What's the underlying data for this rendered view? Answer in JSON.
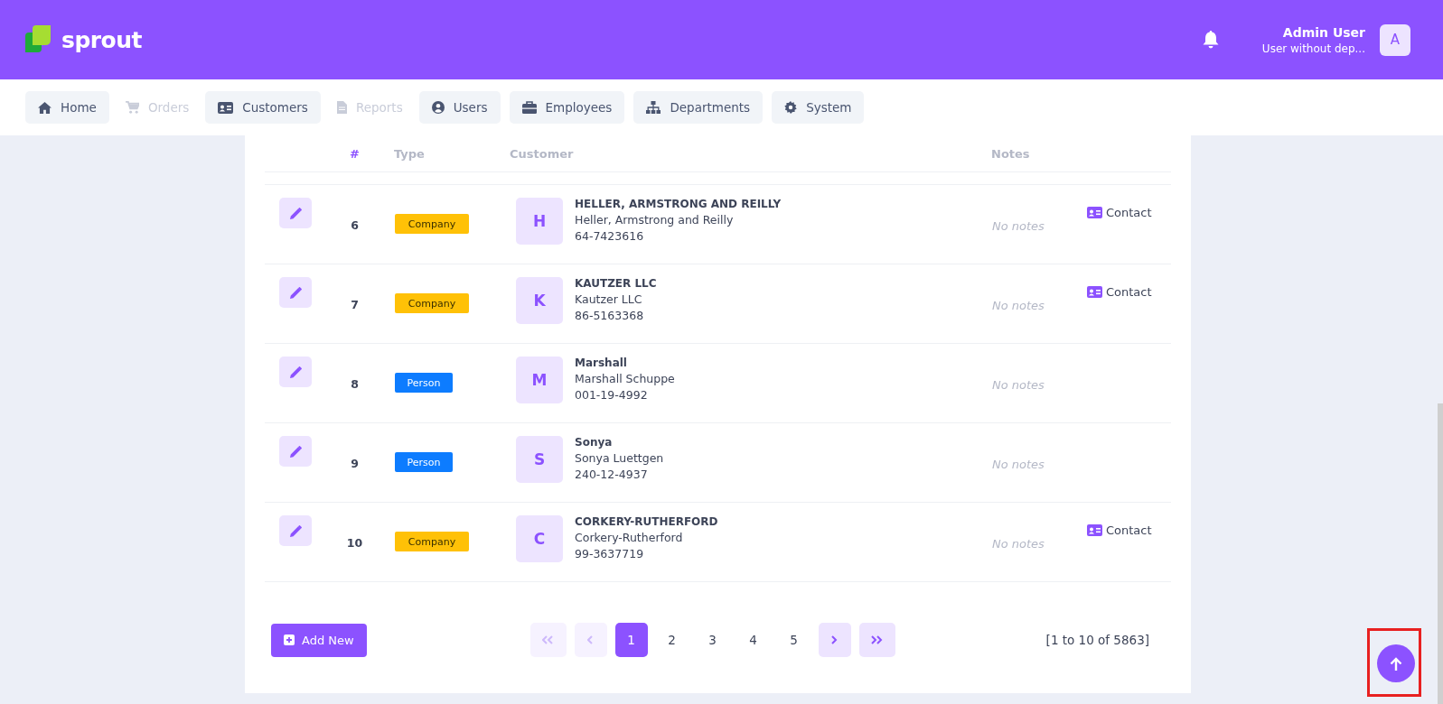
{
  "header": {
    "logo": "sprout",
    "user_name": "Admin User",
    "user_role": "User without dep...",
    "avatar": "A"
  },
  "nav": [
    {
      "label": "Home",
      "disabled": false
    },
    {
      "label": "Orders",
      "disabled": true
    },
    {
      "label": "Customers",
      "disabled": false
    },
    {
      "label": "Reports",
      "disabled": true
    },
    {
      "label": "Users",
      "disabled": false
    },
    {
      "label": "Employees",
      "disabled": false
    },
    {
      "label": "Departments",
      "disabled": false
    },
    {
      "label": "System",
      "disabled": false
    }
  ],
  "table": {
    "columns": [
      "#",
      "Type",
      "Customer",
      "Notes"
    ],
    "rows": [
      {
        "number": "6",
        "type": "Company",
        "kind": "company",
        "initial": "H",
        "title": "HELLER, ARMSTRONG AND REILLY",
        "name": "Heller, Armstrong and Reilly",
        "phone": "64-7423616",
        "notes": "No notes",
        "contact": "Contact"
      },
      {
        "number": "7",
        "type": "Company",
        "kind": "company",
        "initial": "K",
        "title": "KAUTZER LLC",
        "name": "Kautzer LLC",
        "phone": "86-5163368",
        "notes": "No notes",
        "contact": "Contact"
      },
      {
        "number": "8",
        "type": "Person",
        "kind": "person",
        "initial": "M",
        "title": "Marshall",
        "name": "Marshall Schuppe",
        "phone": "001-19-4992",
        "notes": "No notes"
      },
      {
        "number": "9",
        "type": "Person",
        "kind": "person",
        "initial": "S",
        "title": "Sonya",
        "name": "Sonya Luettgen",
        "phone": "240-12-4937",
        "notes": "No notes"
      },
      {
        "number": "10",
        "type": "Company",
        "kind": "company",
        "initial": "C",
        "title": "CORKERY-RUTHERFORD",
        "name": "Corkery-Rutherford",
        "phone": "99-3637719",
        "notes": "No notes",
        "contact": "Contact"
      }
    ]
  },
  "footer": {
    "add_button": "Add New",
    "first": {
      "disabled": true
    },
    "previous": {
      "disabled": true
    },
    "pages": [
      {
        "label": "1",
        "selected": true
      },
      {
        "label": "2",
        "selected": false
      },
      {
        "label": "3",
        "selected": false
      },
      {
        "label": "4",
        "selected": false
      },
      {
        "label": "5",
        "selected": false
      }
    ],
    "next": {
      "disabled": false
    },
    "last": {
      "disabled": false
    },
    "range": "[1 to 10 of 5863]"
  }
}
